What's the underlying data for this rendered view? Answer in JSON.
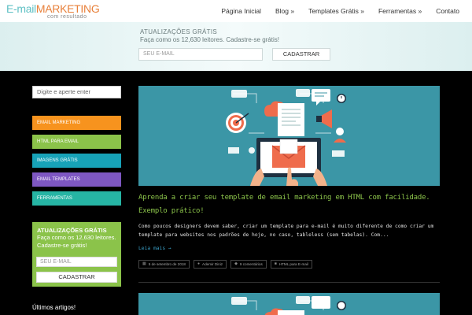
{
  "logo": {
    "part1": "E-mail",
    "part2": "MARKETING",
    "tagline": "com resultado"
  },
  "nav": {
    "items": [
      "Página Inicial",
      "Blog »",
      "Templates Grátis »",
      "Ferramentas »",
      "Contato"
    ]
  },
  "banner": {
    "title": "ATUALIZAÇÕES GRÁTIS",
    "subtitle": "Faça como os 12,630 leitores. Cadastre-se grátis!",
    "email_placeholder": "SEU E-MAIL",
    "button_label": "CADASTRAR"
  },
  "sidebar": {
    "search_placeholder": "Digite e aperte enter",
    "categories": [
      {
        "label": "EMAIL MARKETING",
        "color": "#f7931e"
      },
      {
        "label": "HTML PARA EMAIL",
        "color": "#8bc34a"
      },
      {
        "label": "IMAGENS GRÁTIS",
        "color": "#17a2b8"
      },
      {
        "label": "EMAIL TEMPLATES",
        "color": "#7e57c2"
      },
      {
        "label": "FERRAMENTAS",
        "color": "#26b5a4"
      }
    ],
    "subscribe": {
      "title": "ATUALIZAÇÕES GRÁTIS",
      "text": "Faça como os 12,630 leitores. Cadastre-se grátis!",
      "email_placeholder": "SEU E-MAIL",
      "button_label": "CADASTRAR"
    },
    "recent_heading": "Últimos artigos!"
  },
  "article": {
    "title": "Aprenda a criar seu template de email marketing em HTML com facilidade. Exemplo prático!",
    "excerpt": "Como poucos designers devem saber, criar um template para e-mail é muito diferente de como criar um template para websites nos padrões de hoje, no caso, tableless (sem tabelas). Com...",
    "read_more": "Leia mais →",
    "meta": {
      "date": "5 de setembro de 2018",
      "author": "Ademir Diniz",
      "comments": "9 comentários",
      "category": "HTML para E-mail"
    }
  },
  "colors": {
    "accent_green": "#8bc34a",
    "image_bg": "#3b96a6",
    "link_blue": "#3aa0c8"
  }
}
